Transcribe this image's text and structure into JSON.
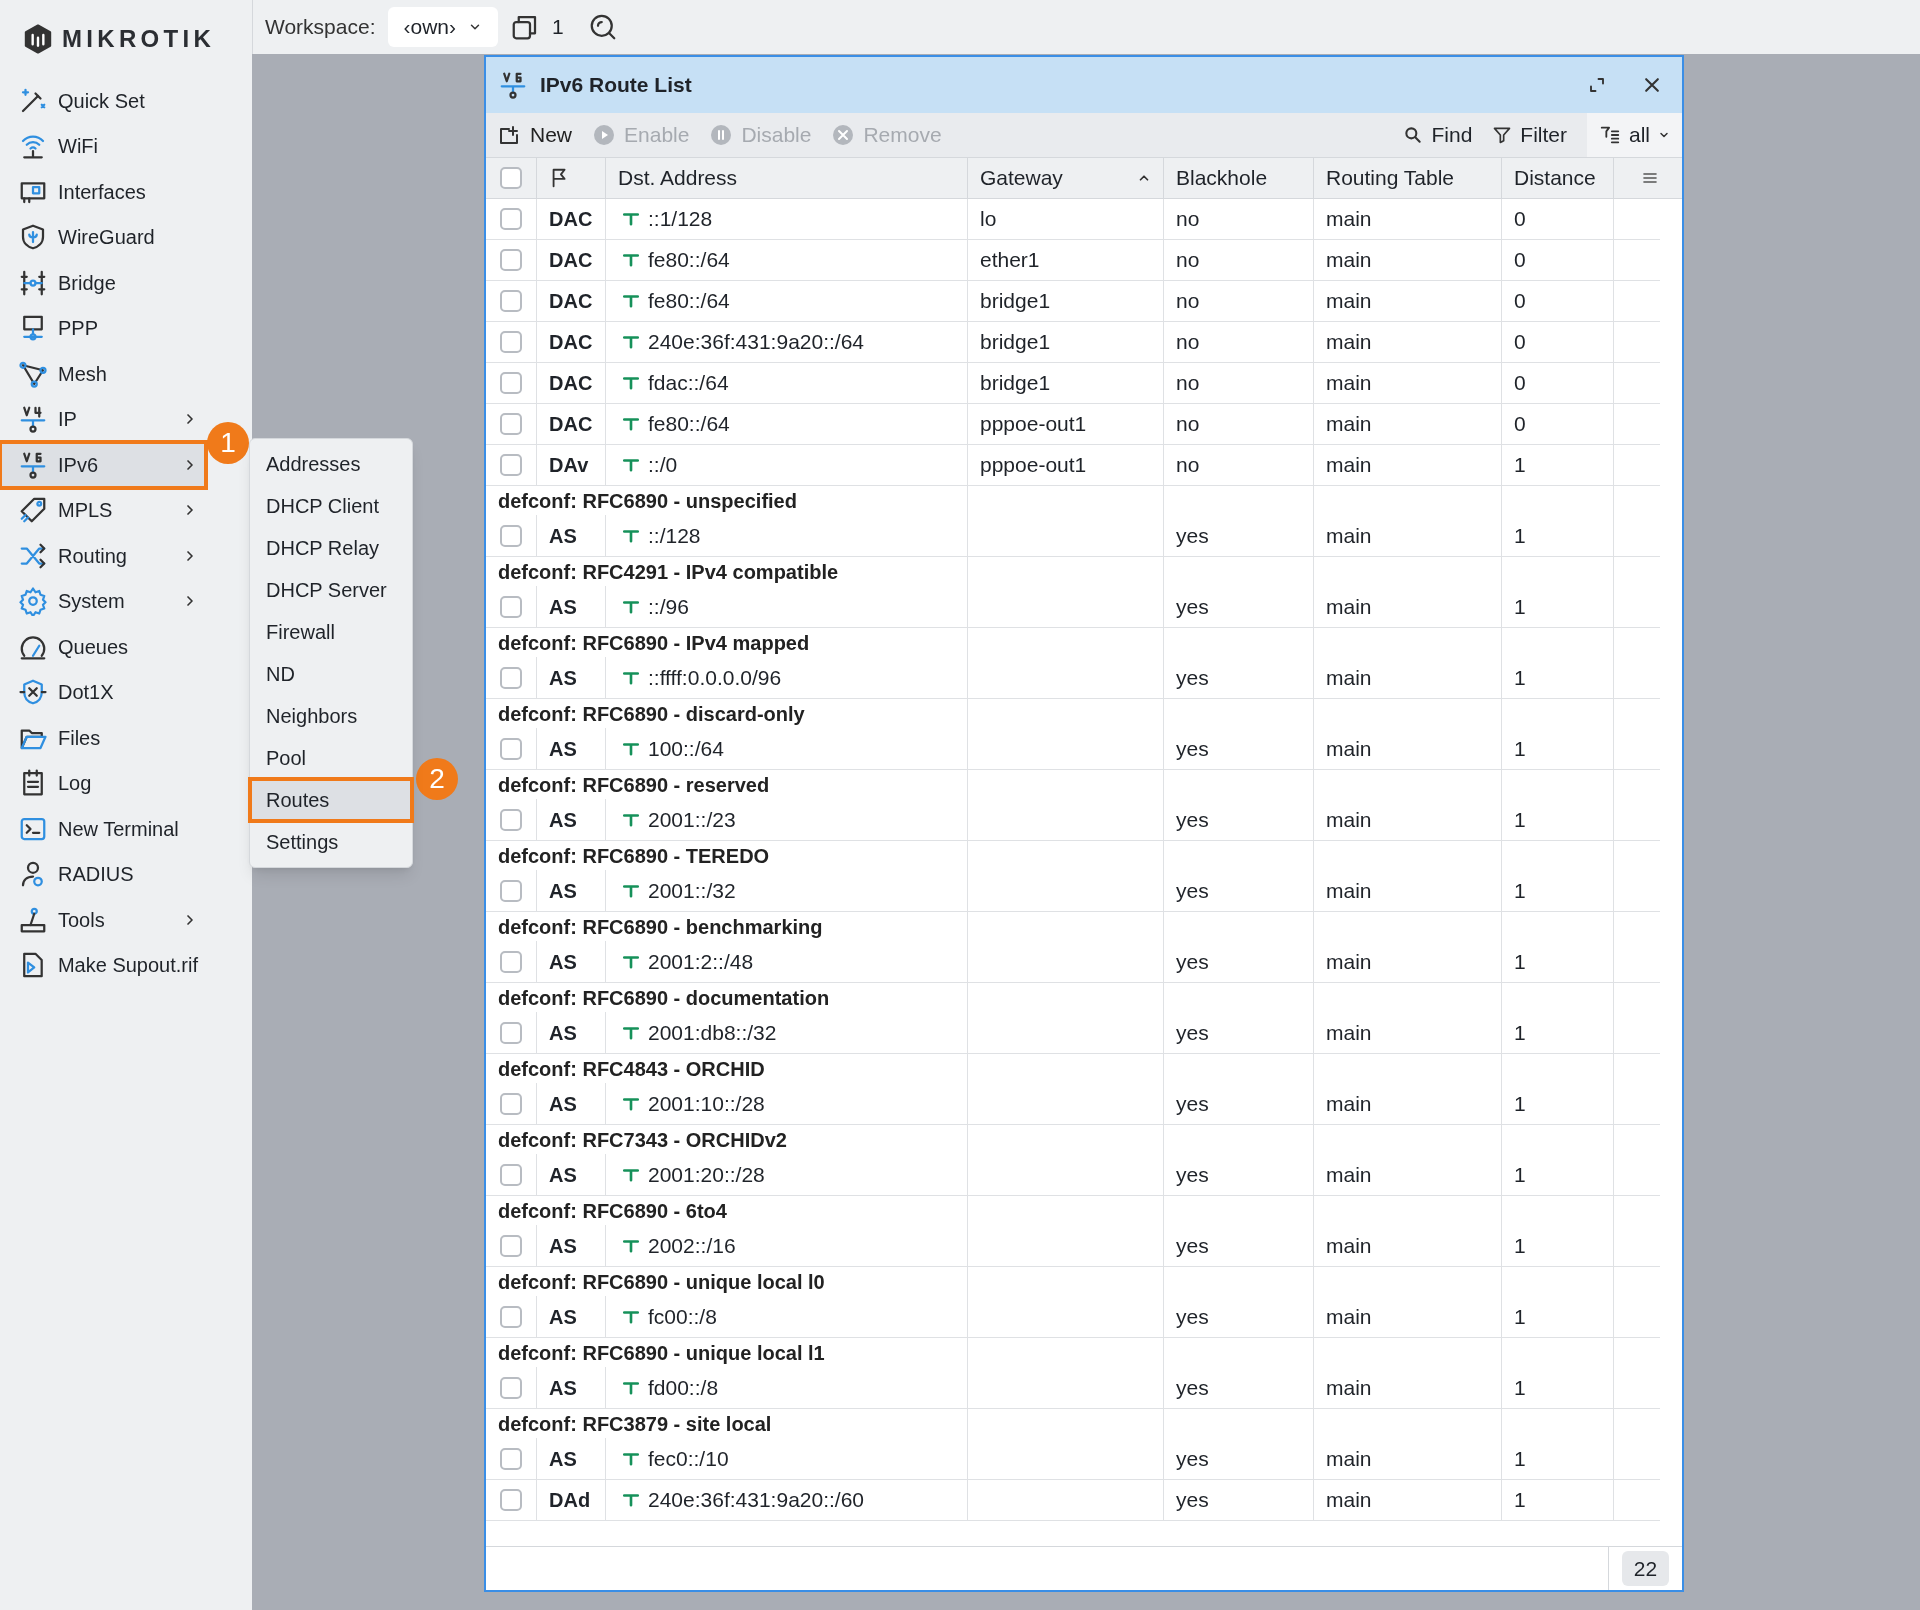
{
  "brand": "MIKROTIK",
  "topbar": {
    "workspace_label": "Workspace:",
    "workspace_value": "‹own›",
    "windows_count": "1"
  },
  "sidebar": {
    "items": [
      {
        "label": "Quick Set",
        "has_submenu": false,
        "selected": false
      },
      {
        "label": "WiFi",
        "has_submenu": false,
        "selected": false
      },
      {
        "label": "Interfaces",
        "has_submenu": false,
        "selected": false
      },
      {
        "label": "WireGuard",
        "has_submenu": false,
        "selected": false
      },
      {
        "label": "Bridge",
        "has_submenu": false,
        "selected": false
      },
      {
        "label": "PPP",
        "has_submenu": false,
        "selected": false
      },
      {
        "label": "Mesh",
        "has_submenu": false,
        "selected": false
      },
      {
        "label": "IP",
        "has_submenu": true,
        "selected": false
      },
      {
        "label": "IPv6",
        "has_submenu": true,
        "selected": true,
        "badge": "1"
      },
      {
        "label": "MPLS",
        "has_submenu": true,
        "selected": false
      },
      {
        "label": "Routing",
        "has_submenu": true,
        "selected": false
      },
      {
        "label": "System",
        "has_submenu": true,
        "selected": false
      },
      {
        "label": "Queues",
        "has_submenu": false,
        "selected": false
      },
      {
        "label": "Dot1X",
        "has_submenu": false,
        "selected": false
      },
      {
        "label": "Files",
        "has_submenu": false,
        "selected": false
      },
      {
        "label": "Log",
        "has_submenu": false,
        "selected": false
      },
      {
        "label": "New Terminal",
        "has_submenu": false,
        "selected": false
      },
      {
        "label": "RADIUS",
        "has_submenu": false,
        "selected": false
      },
      {
        "label": "Tools",
        "has_submenu": true,
        "selected": false
      },
      {
        "label": "Make Supout.rif",
        "has_submenu": false,
        "selected": false
      }
    ]
  },
  "submenu": {
    "items": [
      {
        "label": "Addresses",
        "selected": false
      },
      {
        "label": "DHCP Client",
        "selected": false
      },
      {
        "label": "DHCP Relay",
        "selected": false
      },
      {
        "label": "DHCP Server",
        "selected": false
      },
      {
        "label": "Firewall",
        "selected": false
      },
      {
        "label": "ND",
        "selected": false
      },
      {
        "label": "Neighbors",
        "selected": false
      },
      {
        "label": "Pool",
        "selected": false
      },
      {
        "label": "Routes",
        "selected": true,
        "badge": "2"
      },
      {
        "label": "Settings",
        "selected": false
      }
    ]
  },
  "window": {
    "title": "IPv6 Route List",
    "toolbar": [
      {
        "label": "New",
        "disabled": false
      },
      {
        "label": "Enable",
        "disabled": true
      },
      {
        "label": "Disable",
        "disabled": true
      },
      {
        "label": "Remove",
        "disabled": true
      }
    ],
    "find": "Find",
    "filter": "Filter",
    "view": "all",
    "table": {
      "all_selected": false,
      "columns": [
        {
          "label": "Dst. Address",
          "sorted": false
        },
        {
          "label": "Gateway",
          "sorted": true
        },
        {
          "label": "Blackhole",
          "sorted": false
        },
        {
          "label": "Routing Table",
          "sorted": false
        },
        {
          "label": "Distance",
          "sorted": false
        }
      ],
      "rows": [
        {
          "flags": "DAC",
          "dst": "::1/128",
          "gateway": "lo",
          "blackhole": "no",
          "table": "main",
          "distance": "0",
          "checked": false
        },
        {
          "flags": "DAC",
          "dst": "fe80::/64",
          "gateway": "ether1",
          "blackhole": "no",
          "table": "main",
          "distance": "0",
          "checked": false
        },
        {
          "flags": "DAC",
          "dst": "fe80::/64",
          "gateway": "bridge1",
          "blackhole": "no",
          "table": "main",
          "distance": "0",
          "checked": false
        },
        {
          "flags": "DAC",
          "dst": "240e:36f:431:9a20::/64",
          "gateway": "bridge1",
          "blackhole": "no",
          "table": "main",
          "distance": "0",
          "checked": false
        },
        {
          "flags": "DAC",
          "dst": "fdac::/64",
          "gateway": "bridge1",
          "blackhole": "no",
          "table": "main",
          "distance": "0",
          "checked": false
        },
        {
          "flags": "DAC",
          "dst": "fe80::/64",
          "gateway": "pppoe-out1",
          "blackhole": "no",
          "table": "main",
          "distance": "0",
          "checked": false
        },
        {
          "flags": "DAv",
          "dst": "::/0",
          "gateway": "pppoe-out1",
          "blackhole": "no",
          "table": "main",
          "distance": "1",
          "checked": false
        },
        {
          "comment": "defconf: RFC6890 - unspecified",
          "flags": "AS",
          "dst": "::/128",
          "blackhole": "yes",
          "table": "main",
          "distance": "1",
          "checked": false
        },
        {
          "comment": "defconf: RFC4291 - IPv4 compatible",
          "flags": "AS",
          "dst": "::/96",
          "blackhole": "yes",
          "table": "main",
          "distance": "1",
          "checked": false
        },
        {
          "comment": "defconf: RFC6890 - IPv4 mapped",
          "flags": "AS",
          "dst": "::ffff:0.0.0.0/96",
          "blackhole": "yes",
          "table": "main",
          "distance": "1",
          "checked": false
        },
        {
          "comment": "defconf: RFC6890 - discard-only",
          "flags": "AS",
          "dst": "100::/64",
          "blackhole": "yes",
          "table": "main",
          "distance": "1",
          "checked": false
        },
        {
          "comment": "defconf: RFC6890 - reserved",
          "flags": "AS",
          "dst": "2001::/23",
          "blackhole": "yes",
          "table": "main",
          "distance": "1",
          "checked": false
        },
        {
          "comment": "defconf: RFC6890 - TEREDO",
          "flags": "AS",
          "dst": "2001::/32",
          "blackhole": "yes",
          "table": "main",
          "distance": "1",
          "checked": false
        },
        {
          "comment": "defconf: RFC6890 - benchmarking",
          "flags": "AS",
          "dst": "2001:2::/48",
          "blackhole": "yes",
          "table": "main",
          "distance": "1",
          "checked": false
        },
        {
          "comment": "defconf: RFC6890 - documentation",
          "flags": "AS",
          "dst": "2001:db8::/32",
          "blackhole": "yes",
          "table": "main",
          "distance": "1",
          "checked": false
        },
        {
          "comment": "defconf: RFC4843 - ORCHID",
          "flags": "AS",
          "dst": "2001:10::/28",
          "blackhole": "yes",
          "table": "main",
          "distance": "1",
          "checked": false
        },
        {
          "comment": "defconf: RFC7343 - ORCHIDv2",
          "flags": "AS",
          "dst": "2001:20::/28",
          "blackhole": "yes",
          "table": "main",
          "distance": "1",
          "checked": false
        },
        {
          "comment": "defconf: RFC6890 - 6to4",
          "flags": "AS",
          "dst": "2002::/16",
          "blackhole": "yes",
          "table": "main",
          "distance": "1",
          "checked": false
        },
        {
          "comment": "defconf: RFC6890 - unique local l0",
          "flags": "AS",
          "dst": "fc00::/8",
          "blackhole": "yes",
          "table": "main",
          "distance": "1",
          "checked": false
        },
        {
          "comment": "defconf: RFC6890 - unique local l1",
          "flags": "AS",
          "dst": "fd00::/8",
          "blackhole": "yes",
          "table": "main",
          "distance": "1",
          "checked": false
        },
        {
          "comment": "defconf: RFC3879 - site local",
          "flags": "AS",
          "dst": "fec0::/10",
          "blackhole": "yes",
          "table": "main",
          "distance": "1",
          "checked": false
        },
        {
          "flags": "DAd",
          "dst": "240e:36f:431:9a20::/60",
          "blackhole": "yes",
          "table": "main",
          "distance": "1",
          "checked": false
        }
      ]
    },
    "count": "22"
  }
}
